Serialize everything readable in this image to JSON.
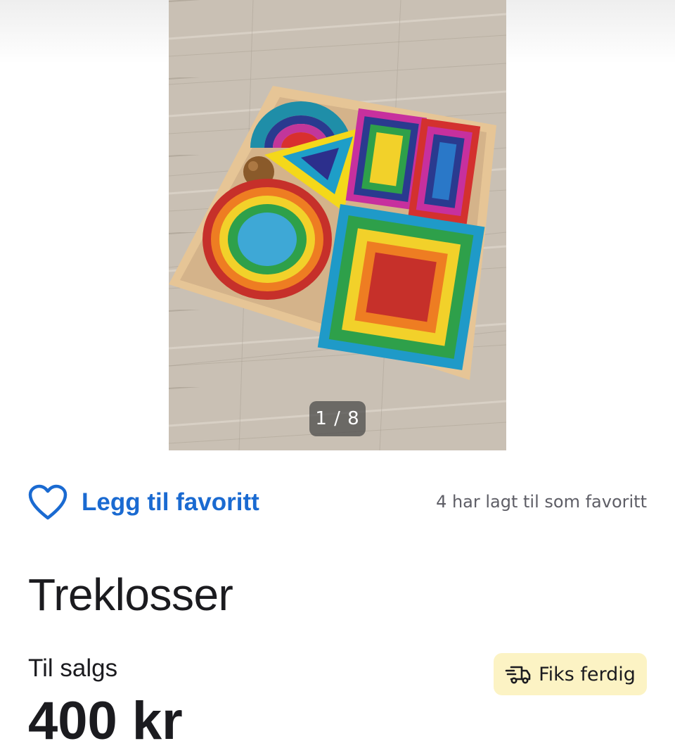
{
  "gallery": {
    "counter": "1 / 8",
    "image_icon": "wooden-shape-puzzle-photo"
  },
  "favorite": {
    "icon": "heart-outline-icon",
    "label": "Legg til favoritt",
    "count_text": "4 har lagt til som favoritt",
    "accent_color": "#1a6ad1"
  },
  "listing": {
    "title": "Treklosser",
    "status": "Til salgs",
    "price": "400 kr"
  },
  "badge": {
    "icon": "delivery-truck-icon",
    "label": "Fiks ferdig",
    "background_color": "#fcf3c4"
  }
}
